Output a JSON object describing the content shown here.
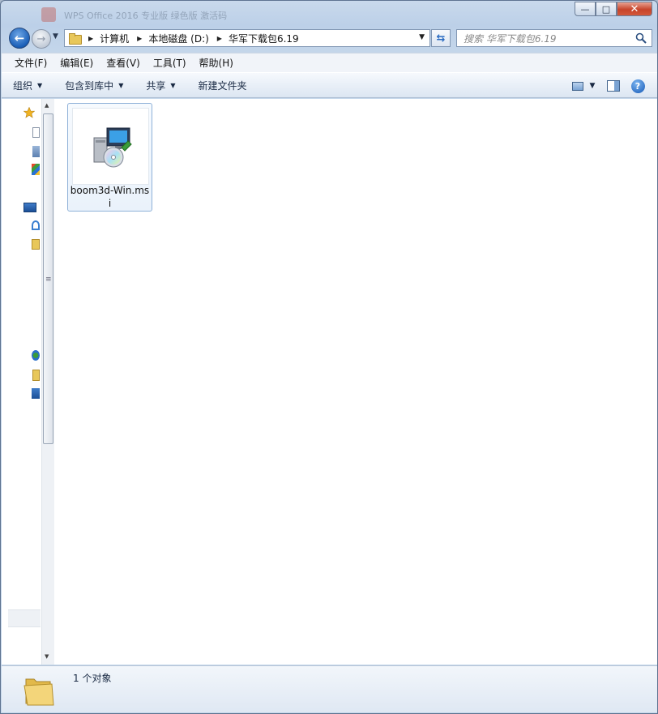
{
  "window": {
    "ghost_title": "WPS Office 2016 专业版 绿色版 激活码",
    "controls": {
      "minimize": "—",
      "maximize": "□",
      "close": "✕"
    }
  },
  "nav": {
    "back": "←",
    "forward": "→",
    "breadcrumbs": [
      "计算机",
      "本地磁盘 (D:)",
      "华军下载包6.19"
    ],
    "search_placeholder": "搜索 华军下载包6.19"
  },
  "menubar": {
    "items": [
      "文件(F)",
      "编辑(E)",
      "查看(V)",
      "工具(T)",
      "帮助(H)"
    ]
  },
  "toolbar": {
    "organize": "组织",
    "include_library": "包含到库中",
    "share": "共享",
    "new_folder": "新建文件夹",
    "help": "?"
  },
  "files": [
    {
      "name": "boom3d-Win.msi",
      "icon": "msi-installer-icon",
      "selected": true
    }
  ],
  "status": {
    "count_text": "1 个对象"
  },
  "colors": {
    "accent": "#1a5fb8",
    "selection_border": "#8fb1d8",
    "folder": "#e8c75a"
  }
}
